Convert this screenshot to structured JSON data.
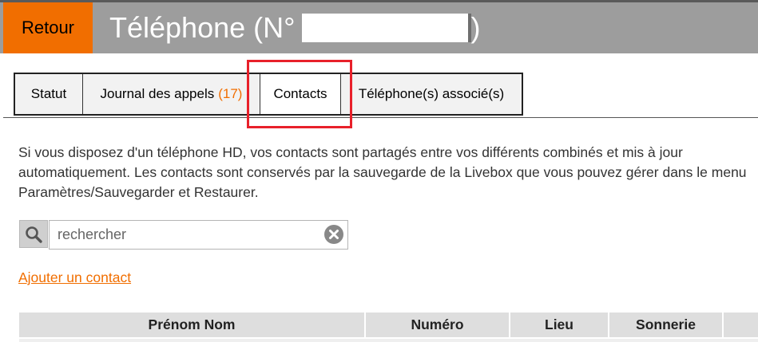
{
  "header": {
    "back_label": "Retour",
    "title_prefix": "Téléphone (N°",
    "title_suffix": ")"
  },
  "tabs": [
    {
      "label": "Statut",
      "active": false
    },
    {
      "label": "Journal des appels",
      "count": "(17)",
      "active": false
    },
    {
      "label": "Contacts",
      "active": true
    },
    {
      "label": "Téléphone(s) associé(s)",
      "active": false
    }
  ],
  "info_text": "Si vous disposez d'un téléphone HD, vos contacts sont partagés entre vos différents combinés et mis à jour automatiquement. Les contacts sont conservés par la sauvegarde de la Livebox que vous pouvez gérer dans le menu Paramètres/Sauvegarder et Restaurer.",
  "search": {
    "placeholder": "rechercher",
    "value": ""
  },
  "add_contact_label": "Ajouter un contact",
  "table": {
    "columns": [
      "Prénom Nom",
      "Numéro",
      "Lieu",
      "Sonnerie",
      ""
    ]
  },
  "colors": {
    "accent": "#f16e00",
    "header_bg": "#9d9d9d",
    "highlight": "#e8202a"
  },
  "icons": {
    "search": "search-icon",
    "clear": "clear-icon"
  }
}
